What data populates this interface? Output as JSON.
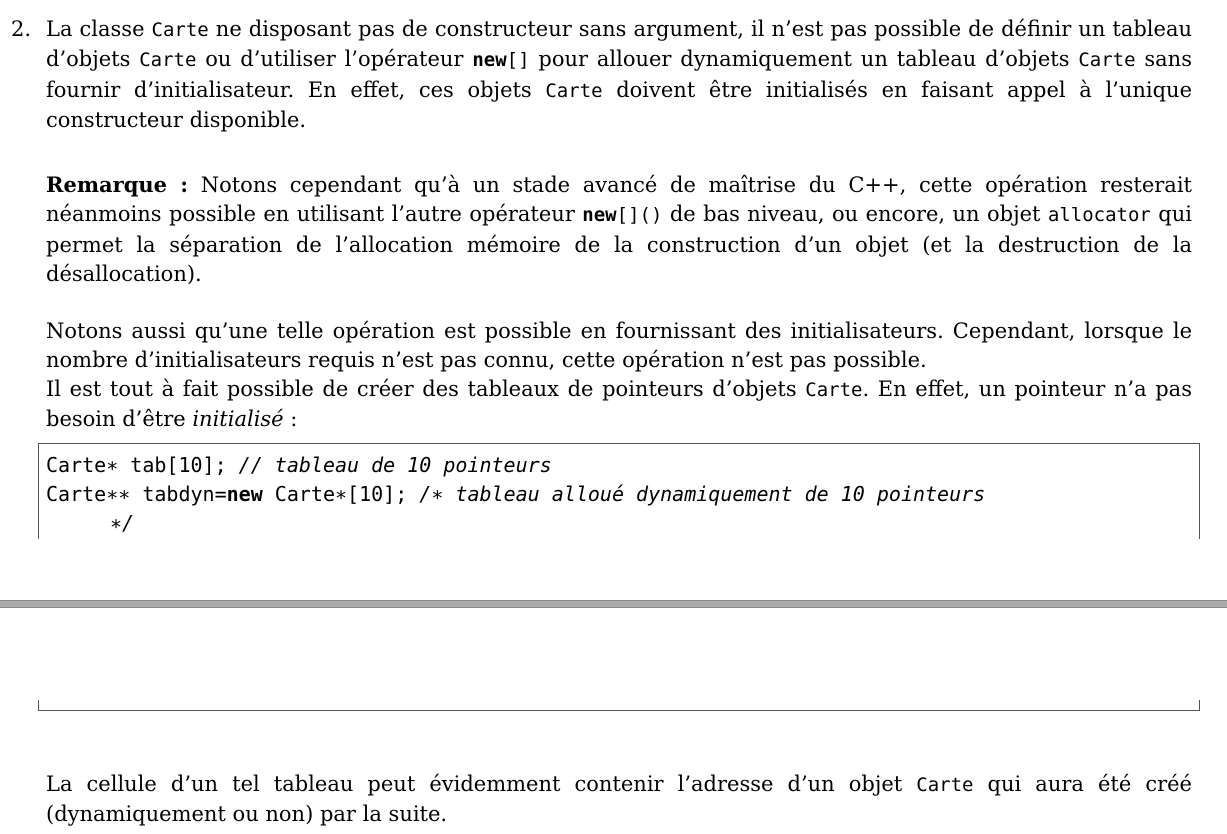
{
  "item": {
    "number": "2.",
    "p1": {
      "t1": "La classe ",
      "c1": "Carte",
      "t2": " ne disposant pas de constructeur sans argument, il n’est pas possible de définir un tableau d’objets ",
      "c2": "Carte",
      "t3": " ou d’utiliser l’opérateur ",
      "c3": "new",
      "c4": "[]",
      "t4": " pour allouer dynamiquement un tableau d’objets ",
      "c5": "Carte",
      "t5": " sans fournir d’initialisateur. En effet, ces objets ",
      "c6": "Carte",
      "t6": " doivent être initialisés en faisant appel à l’unique constructeur disponible."
    },
    "remark": {
      "label": "Remarque :",
      "t1": "  Notons cependant qu’à un stade avancé de maîtrise du C++, cette opération resterait néanmoins possible en utilisant l’autre opérateur ",
      "c1": "new",
      "c2": "[]()",
      "t2": " de bas niveau, ou encore, un objet ",
      "c3": "allocator",
      "t3": " qui permet la séparation de l’allocation mémoire de la construction d’un objet (et la destruction de la désallocation)."
    },
    "p3": "Notons aussi qu’une telle opération est possible en fournissant des initialisateurs. Cependant, lorsque le nombre d’initialisateurs requis n’est pas connu, cette opération n’est pas possible.",
    "p4": {
      "t1": "Il est tout à fait possible de créer des tableaux de pointeurs d’objets ",
      "c1": "Carte",
      "t2": ". En effet, un pointeur n’a pas besoin d’être ",
      "i1": "initialisé",
      "t3": " :"
    },
    "code": {
      "l1_code": "Carte∗ tab[10]; ",
      "l1_comment": "// tableau de 10 pointeurs",
      "l2_pre": "Carte∗∗ tabdyn=",
      "l2_kw": "new",
      "l2_post": " Carte∗[10]; ",
      "l2_comment": "/∗ tableau alloué dynamiquement de 10 pointeurs",
      "l3_comment": "∗/"
    },
    "p5": {
      "t1": "La cellule d’un tel tableau peut évidemment contenir l’adresse d’un objet ",
      "c1": "Carte",
      "t2": " qui aura été créé (dynamiquement ou non) par la suite."
    }
  }
}
